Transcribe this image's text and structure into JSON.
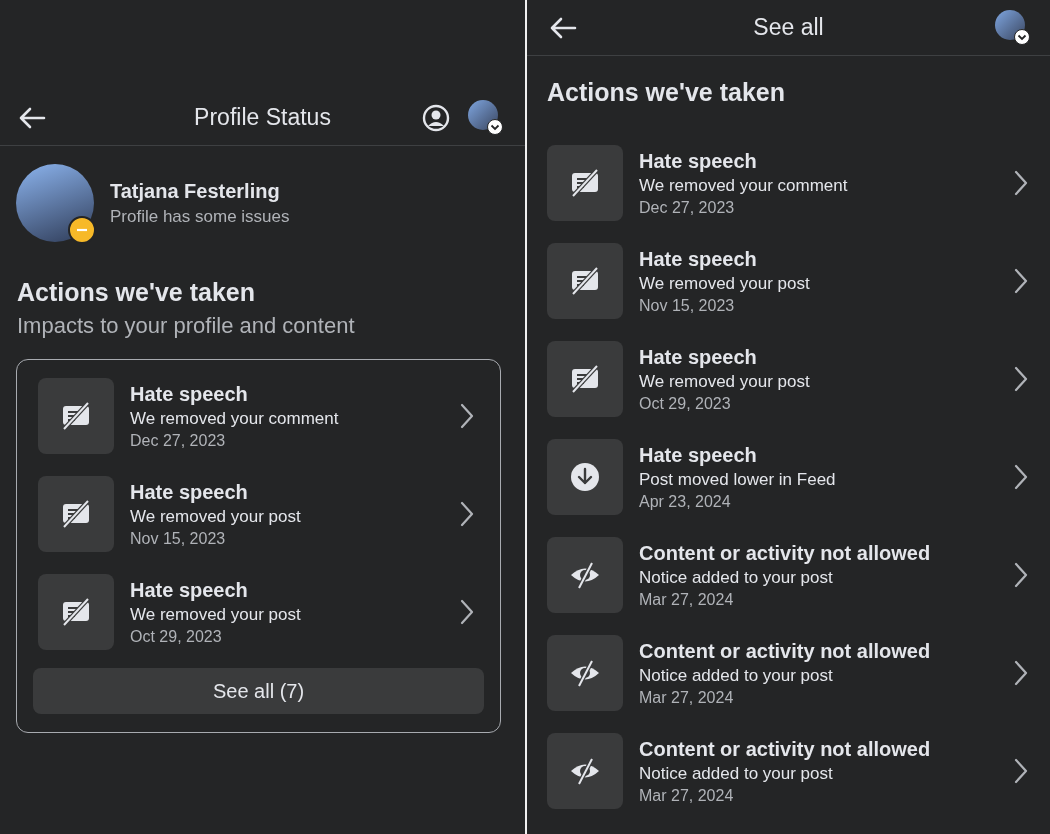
{
  "left_screen": {
    "header": {
      "title": "Profile Status"
    },
    "profile": {
      "name": "Tatjana Festerling",
      "status": "Profile has some issues"
    },
    "section": {
      "title": "Actions we've taken",
      "subtitle": "Impacts to your profile and content"
    },
    "actions": [
      {
        "kind": "removed",
        "title": "Hate speech",
        "detail": "We removed your comment",
        "date": "Dec 27, 2023"
      },
      {
        "kind": "removed",
        "title": "Hate speech",
        "detail": "We removed your post",
        "date": "Nov 15, 2023"
      },
      {
        "kind": "removed",
        "title": "Hate speech",
        "detail": "We removed your post",
        "date": "Oct 29, 2023"
      }
    ],
    "see_all_button": "See all (7)"
  },
  "right_screen": {
    "header": {
      "title": "See all"
    },
    "section_title": "Actions we've taken",
    "actions": [
      {
        "kind": "removed",
        "title": "Hate speech",
        "detail": "We removed your comment",
        "date": "Dec 27, 2023"
      },
      {
        "kind": "removed",
        "title": "Hate speech",
        "detail": "We removed your post",
        "date": "Nov 15, 2023"
      },
      {
        "kind": "removed",
        "title": "Hate speech",
        "detail": "We removed your post",
        "date": "Oct 29, 2023"
      },
      {
        "kind": "lowered",
        "title": "Hate speech",
        "detail": "Post moved lower in Feed",
        "date": "Apr 23, 2024"
      },
      {
        "kind": "hidden",
        "title": "Content or activity not allowed",
        "detail": "Notice added to your post",
        "date": "Mar 27, 2024"
      },
      {
        "kind": "hidden",
        "title": "Content or activity not allowed",
        "detail": "Notice added to your post",
        "date": "Mar 27, 2024"
      },
      {
        "kind": "hidden",
        "title": "Content or activity not allowed",
        "detail": "Notice added to your post",
        "date": "Mar 27, 2024"
      }
    ]
  }
}
